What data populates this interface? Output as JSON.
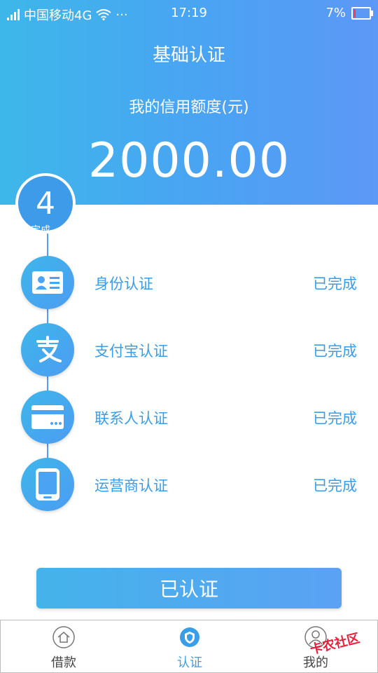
{
  "status_bar": {
    "carrier": "中国移动4G",
    "dots": "···",
    "time": "17:19",
    "battery": "7%"
  },
  "header": {
    "title": "基础认证",
    "credit_label": "我的信用额度(元)",
    "credit_amount": "2000.00"
  },
  "progress": {
    "count": "4",
    "caption": "已完成"
  },
  "items": [
    {
      "label": "身份认证",
      "status": "已完成",
      "icon": "id-card-icon"
    },
    {
      "label": "支付宝认证",
      "status": "已完成",
      "icon": "alipay-icon"
    },
    {
      "label": "联系人认证",
      "status": "已完成",
      "icon": "bank-card-icon"
    },
    {
      "label": "运营商认证",
      "status": "已完成",
      "icon": "phone-icon"
    }
  ],
  "button": {
    "label": "已认证"
  },
  "tabs": [
    {
      "label": "借款",
      "icon": "home-icon"
    },
    {
      "label": "认证",
      "icon": "shield-icon",
      "active": true
    },
    {
      "label": "我的",
      "icon": "user-icon"
    }
  ],
  "watermark": "卡农社区",
  "colors": {
    "primary": "#4aa3f3",
    "accent": "#3a9de8",
    "battery_low": "#ff3b3b"
  }
}
